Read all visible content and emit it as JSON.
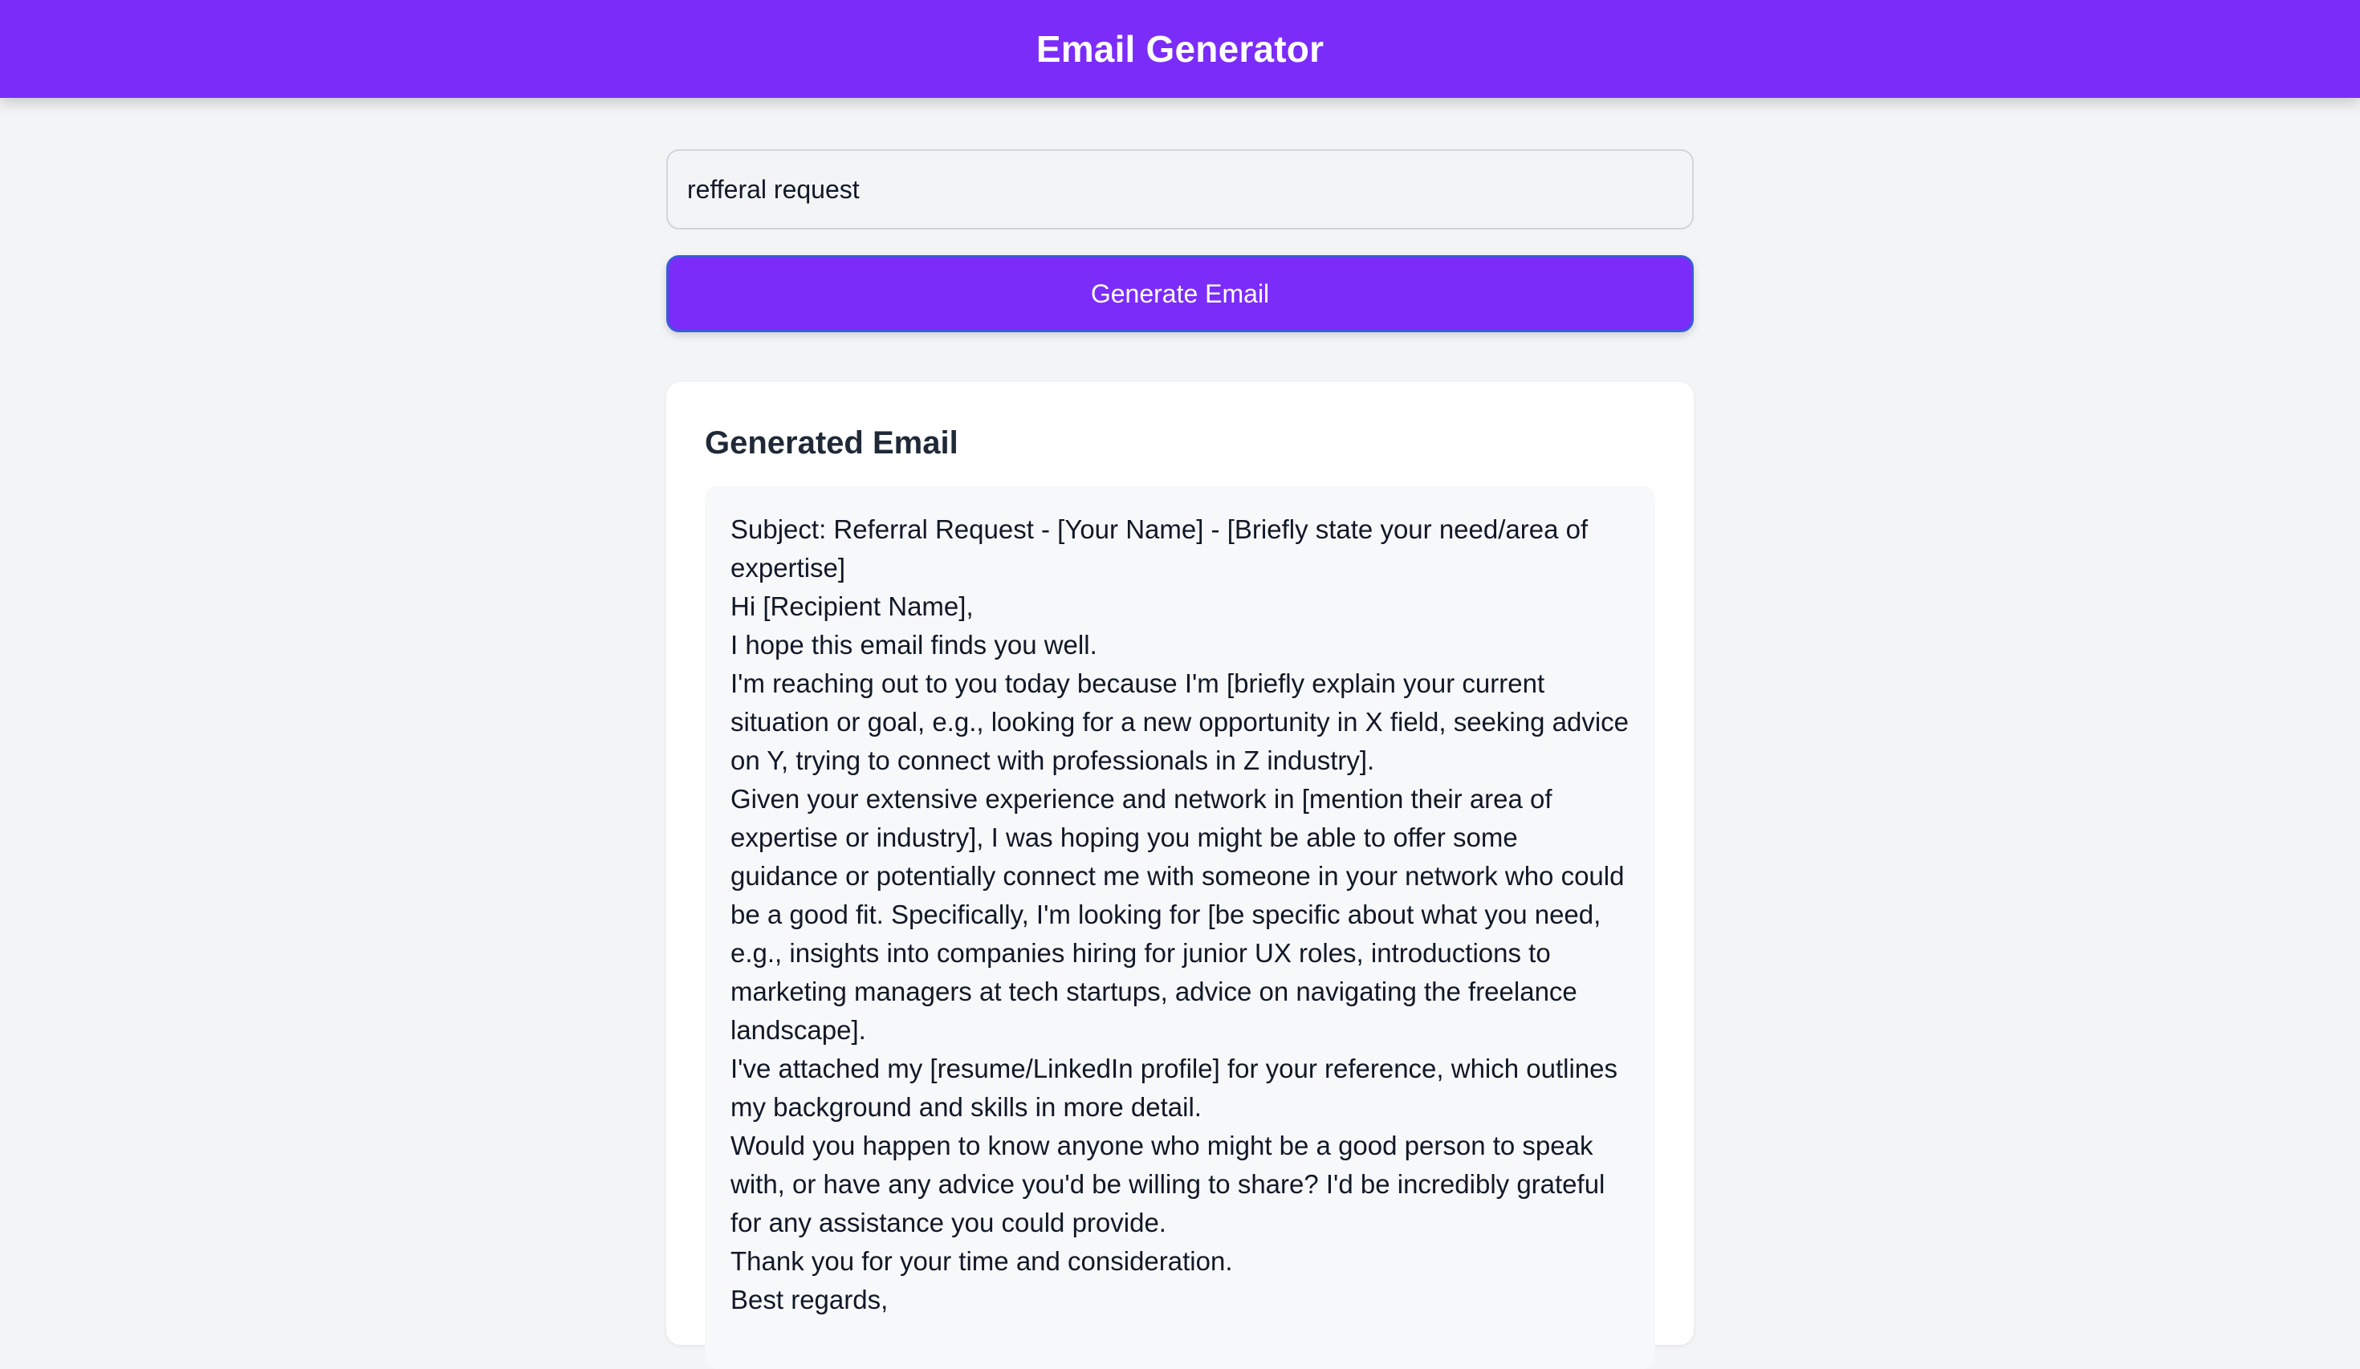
{
  "header": {
    "title": "Email Generator"
  },
  "form": {
    "input_value": "refferal request",
    "generate_label": "Generate Email"
  },
  "result": {
    "title": "Generated Email",
    "lines": [
      "Subject: Referral Request - [Your Name] - [Briefly state your need/area of expertise]",
      "Hi [Recipient Name],",
      "I hope this email finds you well.",
      "I'm reaching out to you today because I'm [briefly explain your current situation or goal, e.g., looking for a new opportunity in X field, seeking advice on Y, trying to connect with professionals in Z industry].",
      "Given your extensive experience and network in [mention their area of expertise or industry], I was hoping you might be able to offer some guidance or potentially connect me with someone in your network who could be a good fit. Specifically, I'm looking for [be specific about what you need, e.g., insights into companies hiring for junior UX roles, introductions to marketing managers at tech startups, advice on navigating the freelance landscape].",
      "I've attached my [resume/LinkedIn profile] for your reference, which outlines my background and skills in more detail.",
      "Would you happen to know anyone who might be a good person to speak with, or have any advice you'd be willing to share? I'd be incredibly grateful for any assistance you could provide.",
      "Thank you for your time and consideration.",
      "Best regards,"
    ]
  },
  "colors": {
    "accent": "#7b2cf9",
    "background": "#f3f4f6",
    "card": "#ffffff"
  }
}
